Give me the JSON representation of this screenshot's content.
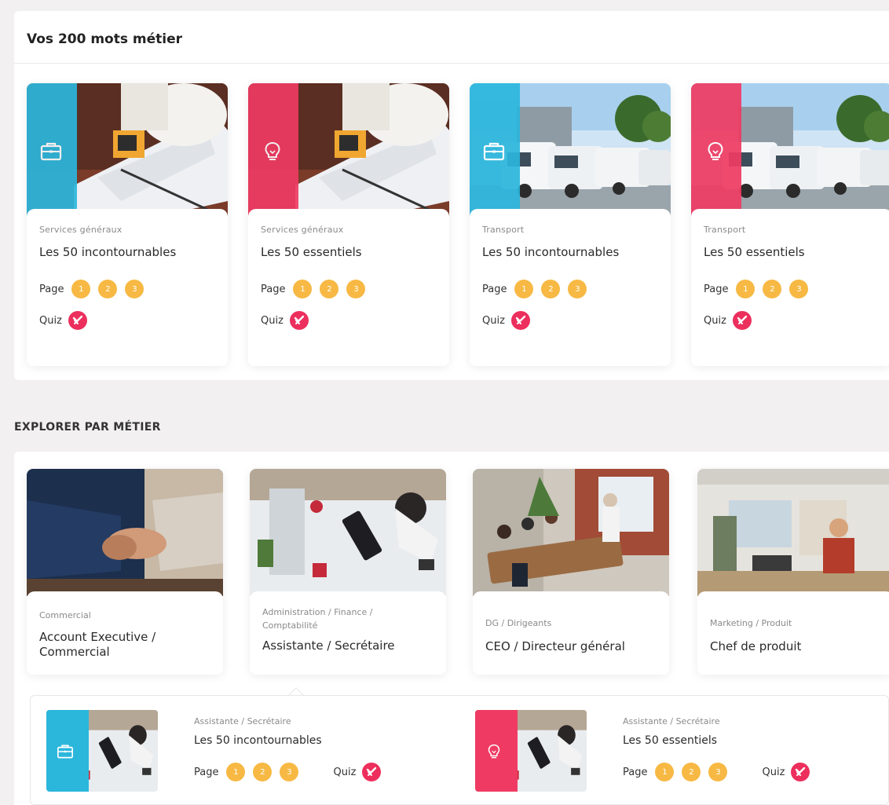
{
  "top_section": {
    "title": "Vos 200 mots métier",
    "cards": [
      {
        "category": "Services généraux",
        "title": "Les 50 incontournables",
        "accent": "#2bb6dc",
        "icon": "briefcase-icon",
        "image": "stamp-documents-photo"
      },
      {
        "category": "Services généraux",
        "title": "Les 50 essentiels",
        "accent": "#ef3b63",
        "icon": "lightbulb-icon",
        "image": "stamp-documents-photo"
      },
      {
        "category": "Transport",
        "title": "Les 50 incontournables",
        "accent": "#2bb6dc",
        "icon": "briefcase-icon",
        "image": "delivery-vans-photo"
      },
      {
        "category": "Transport",
        "title": "Les 50 essentiels",
        "accent": "#ef3b63",
        "icon": "lightbulb-icon",
        "image": "delivery-vans-photo"
      }
    ],
    "page_label": "Page",
    "pages": [
      "1",
      "2",
      "3"
    ],
    "quiz_label": "Quiz"
  },
  "explore_section": {
    "title": "EXPLORER PAR MÉTIER",
    "jobs": [
      {
        "category": "Commercial",
        "title": "Account Executive / Commercial",
        "image": "handshake-photo"
      },
      {
        "category": "Administration / Finance / Comptabilité",
        "title": "Assistante / Secrétaire",
        "image": "office-desk-photo"
      },
      {
        "category": "DG / Dirigeants",
        "title": "CEO / Directeur général",
        "image": "meeting-room-photo"
      },
      {
        "category": "Marketing / Produit",
        "title": "Chef de produit",
        "image": "office-workspace-photo"
      }
    ],
    "selected_job_items": [
      {
        "category": "Assistante / Secrétaire",
        "title": "Les 50 incontournables",
        "accent": "#2bb6dc",
        "icon": "briefcase-icon"
      },
      {
        "category": "Assistante / Secrétaire",
        "title": "Les 50 essentiels",
        "accent": "#ef3b63",
        "icon": "lightbulb-icon"
      }
    ],
    "page_label": "Page",
    "pages": [
      "1",
      "2",
      "3"
    ],
    "quiz_label": "Quiz"
  },
  "colors": {
    "blue": "#2bb6dc",
    "pink": "#ef3b63",
    "page_dot": "#f7b944",
    "quiz": "#ec2f5d"
  }
}
